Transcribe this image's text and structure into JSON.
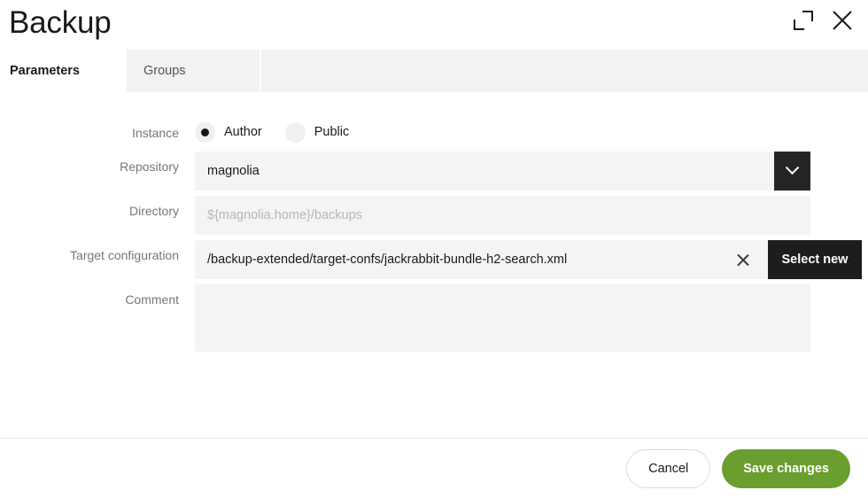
{
  "header": {
    "title": "Backup",
    "maximize_icon": "expand-icon",
    "close_icon": "close-icon"
  },
  "tabs": [
    {
      "label": "Parameters",
      "active": true
    },
    {
      "label": "Groups",
      "active": false
    }
  ],
  "form": {
    "instance": {
      "label": "Instance",
      "options": [
        {
          "label": "Author",
          "selected": true
        },
        {
          "label": "Public",
          "selected": false
        }
      ],
      "help": "?"
    },
    "repository": {
      "label": "Repository",
      "value": "magnolia",
      "dropdown_icon": "chevron-down-icon",
      "help": "?"
    },
    "directory": {
      "label": "Directory",
      "value": "",
      "placeholder": "${magnolia.home}/backups"
    },
    "target_configuration": {
      "label": "Target configuration",
      "value": "/backup-extended/target-confs/jackrabbit-bundle-h2-search.xml",
      "clear_icon": "close-icon",
      "select_new_label": "Select new"
    },
    "comment": {
      "label": "Comment",
      "value": "",
      "placeholder": ""
    }
  },
  "footer": {
    "cancel_label": "Cancel",
    "save_label": "Save changes"
  },
  "colors": {
    "accent_green": "#6a9e2f",
    "dark_button": "#1d1d1d",
    "field_background": "#f4f4f4"
  }
}
